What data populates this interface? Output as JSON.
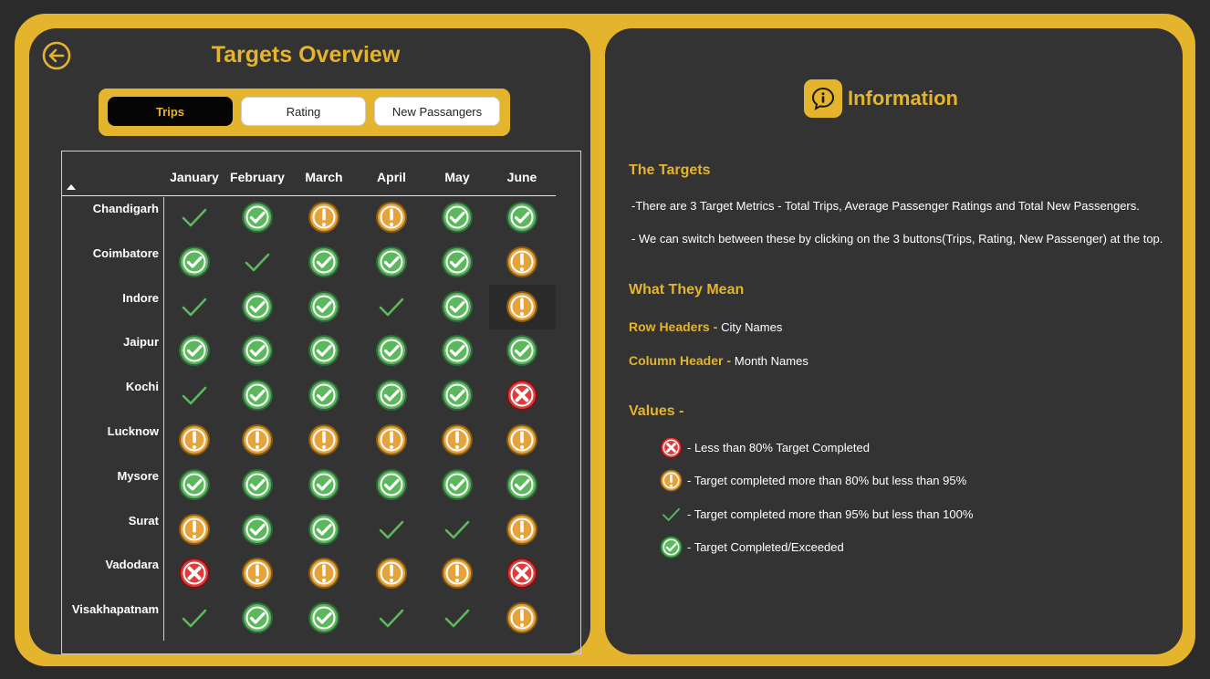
{
  "header": {
    "title": "Targets Overview",
    "back_icon": "arrow-left-circle-icon"
  },
  "tabs": [
    {
      "label": "Trips",
      "active": true
    },
    {
      "label": "Rating",
      "active": false
    },
    {
      "label": "New Passangers",
      "active": false
    }
  ],
  "matrix": {
    "months": [
      "January",
      "February",
      "March",
      "April",
      "May",
      "June"
    ],
    "cities": [
      "Chandigarh",
      "Coimbatore",
      "Indore",
      "Jaipur",
      "Kochi",
      "Lucknow",
      "Mysore",
      "Surat",
      "Vadodara",
      "Visakhapatnam"
    ],
    "status_key": {
      "x": "less-than-80",
      "w": "80-to-95",
      "t": "95-to-100",
      "c": "completed-exceeded"
    },
    "statuses": [
      [
        "t",
        "c",
        "w",
        "w",
        "c",
        "c"
      ],
      [
        "c",
        "t",
        "c",
        "c",
        "c",
        "w"
      ],
      [
        "t",
        "c",
        "c",
        "t",
        "c",
        "w"
      ],
      [
        "c",
        "c",
        "c",
        "c",
        "c",
        "c"
      ],
      [
        "t",
        "c",
        "c",
        "c",
        "c",
        "x"
      ],
      [
        "w",
        "w",
        "w",
        "w",
        "w",
        "w"
      ],
      [
        "c",
        "c",
        "c",
        "c",
        "c",
        "c"
      ],
      [
        "w",
        "c",
        "c",
        "t",
        "t",
        "w"
      ],
      [
        "x",
        "w",
        "w",
        "w",
        "w",
        "x"
      ],
      [
        "t",
        "c",
        "c",
        "t",
        "t",
        "w"
      ]
    ],
    "highlighted_cell": {
      "row": 1,
      "col": 5
    }
  },
  "info": {
    "title": "Information",
    "icon": "info-chat-icon",
    "targets_title": "The Targets",
    "targets_line1": "-There are 3 Target Metrics - Total Trips, Average Passenger Ratings and Total New Passengers.",
    "targets_line2": "- We can switch between these by clicking on the 3 buttons(Trips, Rating, New Passenger) at the top.",
    "meaning_title": "What They Mean",
    "row_headers_key": "Row Headers -",
    "row_headers_val": "City Names",
    "col_header_key": "Column Header -",
    "col_header_val": "Month Names",
    "values_title": "Values -",
    "legend": [
      {
        "status": "x",
        "text": "- Less than 80% Target Completed"
      },
      {
        "status": "w",
        "text": "- Target completed more than 80% but less than 95%"
      },
      {
        "status": "t",
        "text": "- Target completed more than 95% but less than 100%"
      },
      {
        "status": "c",
        "text": "- Target Completed/Exceeded"
      }
    ]
  },
  "colors": {
    "accent": "#e4b42c",
    "panel": "#333333",
    "green": "#5cb85c",
    "orange": "#e6a33a",
    "red": "#e03a3a"
  }
}
